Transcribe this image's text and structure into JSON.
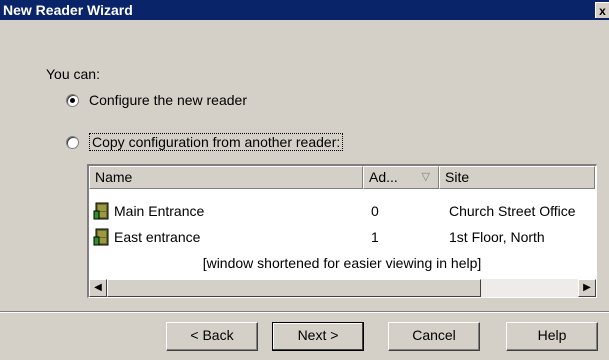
{
  "window": {
    "title": "New Reader Wizard",
    "close_glyph": "x"
  },
  "intro": "You can:",
  "options": [
    {
      "label": "Configure the new reader",
      "checked": true
    },
    {
      "label": "Copy configuration from another reader:",
      "checked": false
    }
  ],
  "list": {
    "columns": [
      "Name",
      "Ad...",
      "Site"
    ],
    "sort_indicator": "▽",
    "rows": [
      {
        "name": "Main Entrance",
        "address": "0",
        "site": "Church Street Office",
        "icon": "door-icon"
      },
      {
        "name": "East entrance",
        "address": "1",
        "site": "1st Floor, North",
        "icon": "door-icon"
      }
    ],
    "note": "[window shortened for easier viewing in help]"
  },
  "buttons": {
    "back": "< Back",
    "next": "Next >",
    "cancel": "Cancel",
    "help": "Help"
  },
  "colors": {
    "titlebar": "#0a246a",
    "face": "#d4d0c8"
  }
}
